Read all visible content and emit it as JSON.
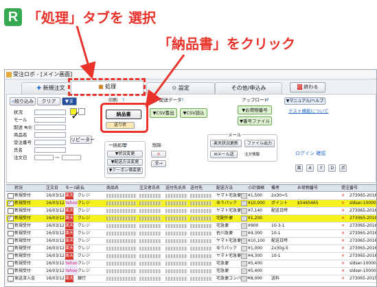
{
  "callouts": {
    "first": "「処理」タブを 選択",
    "second": "「納品書」をクリック"
  },
  "window": {
    "title": "受注ロボ - [メイン画面]"
  },
  "tabs": [
    {
      "label": "新規注文"
    },
    {
      "label": "処理"
    },
    {
      "label": "設定"
    },
    {
      "label": "その他/申込み"
    }
  ],
  "close_label": "終わる",
  "manual": {
    "label": "▼マニュアル/ヘルプ",
    "link": "テスト機能について"
  },
  "filter": {
    "narrow": "絞り込み",
    "clear": "クリア",
    "dropdown": "▼ま",
    "status": "状況",
    "mall": "モール",
    "delivery": "配送",
    "delivery_sub": "無/別",
    "product": "商品名",
    "order_no": "受注番号",
    "name": "氏名",
    "order_date": "注文日",
    "wave": "～",
    "repeater": "リピーター"
  },
  "print": {
    "label": "印刷",
    "help": "?",
    "nouhin": "納品書",
    "other": "送り状"
  },
  "delivery_data": {
    "label": "配送データ",
    "help": "?",
    "csv_out": "▼CSV書出",
    "csv_in": "▼CSV読込"
  },
  "upload": {
    "label": "アップロード",
    "help": "?",
    "inquiry": "▼お荷物番号",
    "bangou": "▼番号ファイル"
  },
  "bulk": {
    "label": "一括処理",
    "help": "?",
    "status_change": "▼状況変更",
    "delivery_change": "▼配送方法変更",
    "coupon": "▼クーポン価変更"
  },
  "delete": {
    "label": "削除",
    "x": "×",
    "all": "全→"
  },
  "mail": {
    "label": "メール",
    "send": "楽天状況更新",
    "file_out": "ファイル出力",
    "mail_btn": "メール送",
    "mail_sub": "注文情報"
  },
  "login": {
    "label": "ログイン 確認",
    "boxes": [
      "楽",
      "A",
      "Y",
      "D",
      "ポ"
    ]
  },
  "grid": {
    "headers": [
      "状況",
      "注文日",
      "モール",
      "支払",
      "商品名",
      "注文者氏名",
      "送付先氏名",
      "送付先",
      "配送方法",
      "小計価格",
      "備考",
      "お荷物番号",
      "受注番号"
    ],
    "rows": [
      {
        "status": "新規受付",
        "date": "16/03/12",
        "mall": "楽天",
        "pay": "クレジ",
        "ship": "ヤマト宅急便",
        "price": "¥1,500",
        "memo": "2x30=5",
        "track": "",
        "order": "273065-20160112-0"
      },
      {
        "status": "新規受付",
        "date": "16/03/12",
        "mall": "Yahoo",
        "pay": "クレジ",
        "ship": "ゆうパック",
        "price": "¥10,000",
        "memo": "ポイント",
        "track": "$5465465",
        "order": "sldser-10000210"
      },
      {
        "status": "新規受付",
        "date": "16/03/12",
        "mall": "楽天",
        "pay": "クレジ",
        "ship": "ヤマト宅急便",
        "price": "¥7,140",
        "memo": "配送日時",
        "track": "",
        "order": "273065-20160110-1"
      },
      {
        "status": "新規受付",
        "date": "16/03/12",
        "mall": "楽天",
        "pay": "クレジ",
        "ship": "宅配外便",
        "price": "¥1,200",
        "memo": "",
        "track": "",
        "order": "273065-20160110-0"
      },
      {
        "status": "新規受付",
        "date": "16/03/12",
        "mall": "楽天",
        "pay": "クレジ",
        "ship": "宅急便",
        "price": "¥900",
        "memo": "10-3-1",
        "track": "",
        "order": "273065-20160110-1"
      },
      {
        "status": "新規受付",
        "date": "16/03/12",
        "mall": "楽天",
        "pay": "クレジ",
        "ship": "佐川急便",
        "price": "¥4,300",
        "memo": "10-1",
        "track": "",
        "order": "273065-20160110-0"
      },
      {
        "status": "新規受付",
        "date": "16/03/12",
        "mall": "楽天",
        "pay": "クレジ",
        "ship": "ヤマト宅急便",
        "price": "¥10,100",
        "memo": "配送日時",
        "track": "",
        "order": "273065-20160109-1"
      },
      {
        "status": "新規受付",
        "date": "16/03/12",
        "mall": "楽天",
        "pay": "クレジ",
        "ship": "ゆうパック",
        "price": "¥1,000",
        "memo": "2x30g-5",
        "track": "",
        "order": "273065-20160109-0"
      },
      {
        "status": "新規受付",
        "date": "16/03/12",
        "mall": "楽天",
        "pay": "クレジ",
        "ship": "ヤマト宅急便",
        "price": "¥4,300",
        "memo": "10-1",
        "track": "",
        "order": "273065-20160108-0"
      },
      {
        "status": "新規受付",
        "date": "16/03/12",
        "mall": "Yahoo",
        "pay": "クレジ",
        "ship": "宅急便",
        "price": "¥5,400",
        "memo": "",
        "track": "",
        "order": "sldser-10000197"
      },
      {
        "status": "新規受付",
        "date": "16/03/12",
        "mall": "Yahoo",
        "pay": "クレジ",
        "ship": "宅急便",
        "price": "¥5,400",
        "memo": "",
        "track": "",
        "order": "sldser-10000208"
      },
      {
        "status": "発送済入金",
        "date": "16/03/12",
        "mall": "楽天",
        "pay": "銀行",
        "ship": "宅急便コンパクト",
        "price": "¥8,000",
        "memo": "送料",
        "track": "",
        "order": "273065-20151120-0"
      }
    ]
  },
  "colors": {
    "accent": "#e8322a",
    "green": "#35a852",
    "highlight": "#f5f11c"
  }
}
